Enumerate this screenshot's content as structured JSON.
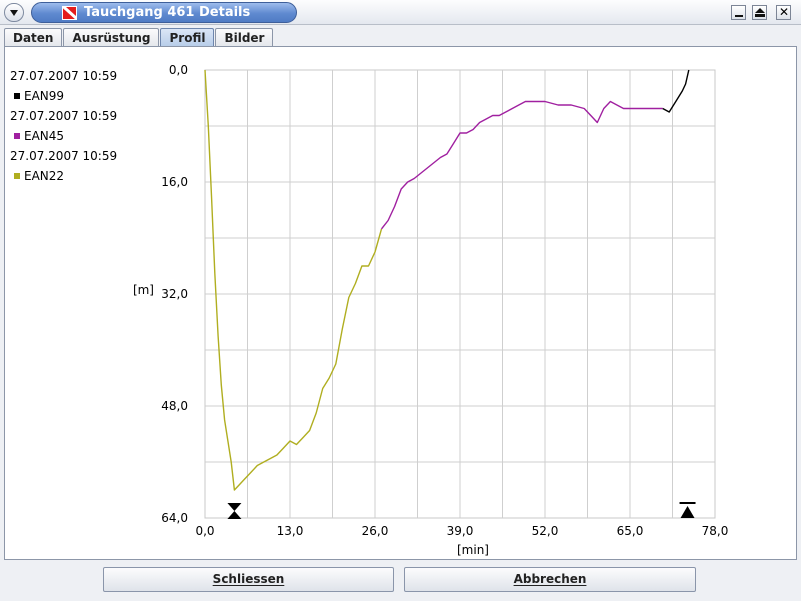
{
  "window": {
    "title": "Tauchgang 461 Details"
  },
  "tabs": [
    {
      "label": "Daten"
    },
    {
      "label": "Ausrüstung"
    },
    {
      "label": "Profil",
      "active": true
    },
    {
      "label": "Bilder"
    }
  ],
  "legend": [
    {
      "time": "27.07.2007 10:59",
      "gas": "EAN99",
      "color": "#000000"
    },
    {
      "time": "27.07.2007 10:59",
      "gas": "EAN45",
      "color": "#a020a0"
    },
    {
      "time": "27.07.2007 10:59",
      "gas": "EAN22",
      "color": "#b0ae20"
    }
  ],
  "buttons": {
    "close": "Schliessen",
    "cancel": "Abbrechen"
  },
  "chart_data": {
    "type": "line",
    "xlabel": "[min]",
    "ylabel": "[m]",
    "xlim": [
      0,
      78
    ],
    "ylim": [
      64,
      0
    ],
    "y_inverted": true,
    "grid": true,
    "x_ticks": [
      "0,0",
      "13,0",
      "26,0",
      "39,0",
      "52,0",
      "65,0",
      "78,0"
    ],
    "y_ticks": [
      "0,0",
      "16,0",
      "32,0",
      "48,0",
      "64,0"
    ],
    "series": [
      {
        "name": "EAN22",
        "color": "#b0ae20",
        "x": [
          0,
          0.5,
          1.0,
          1.5,
          2.0,
          2.5,
          3.0,
          3.5,
          4.0,
          4.5,
          5.0,
          6.0,
          7.0,
          8.0,
          9.0,
          10.0,
          11.0,
          12.0,
          13.0,
          14.0,
          15.0,
          16.0,
          17.0,
          18.0,
          19.0,
          20.0,
          21.0,
          22.0,
          23.0,
          24.0,
          25.0,
          26.0,
          27.0
        ],
        "y": [
          0,
          8,
          18,
          29,
          38,
          45,
          50,
          53,
          56,
          60,
          59.5,
          58.5,
          57.5,
          56.5,
          56,
          55.5,
          55,
          54,
          53,
          53.5,
          52.5,
          51.5,
          49,
          45.5,
          44,
          42,
          37,
          32.5,
          30.5,
          28,
          28,
          26,
          22.7
        ]
      },
      {
        "name": "EAN45",
        "color": "#a020a0",
        "x": [
          27,
          28,
          29,
          30,
          31,
          32,
          34,
          36,
          37,
          38,
          39,
          40,
          41,
          42,
          43,
          44,
          45,
          46,
          47,
          48,
          49,
          50,
          52,
          54,
          56,
          58,
          59,
          60,
          61,
          62,
          63,
          64,
          66,
          68,
          70
        ],
        "y": [
          22.7,
          21.5,
          19.5,
          17,
          16,
          15.5,
          14,
          12.5,
          12,
          10.5,
          9,
          9,
          8.5,
          7.5,
          7,
          6.5,
          6.5,
          6,
          5.5,
          5,
          4.5,
          4.5,
          4.5,
          5,
          5,
          5.5,
          6.5,
          7.5,
          5.5,
          4.5,
          5,
          5.5,
          5.5,
          5.5,
          5.5
        ]
      },
      {
        "name": "EAN99",
        "color": "#000000",
        "x": [
          70,
          71,
          72,
          73,
          73.5,
          74
        ],
        "y": [
          5.5,
          6,
          4.5,
          3,
          2,
          0
        ]
      }
    ]
  }
}
